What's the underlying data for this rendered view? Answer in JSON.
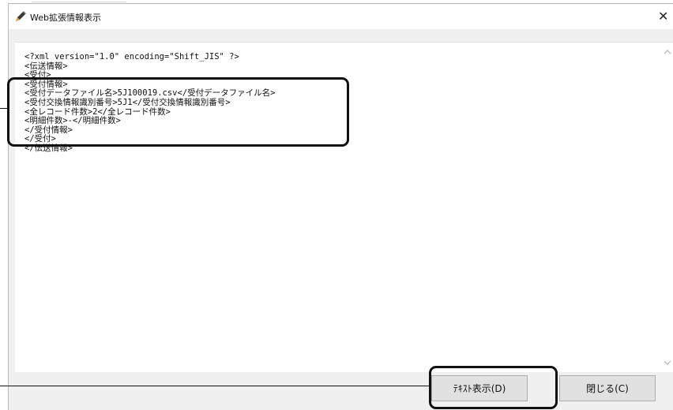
{
  "window": {
    "title": "Web拡張情報表示",
    "close_glyph": "✕"
  },
  "content": {
    "lines": [
      "<?xml version=\"1.0\" encoding=\"Shift_JIS\" ?>",
      "<伝送情報>",
      "<受付>",
      "<受付情報>",
      "<受付データファイル名>5J100019.csv</受付データファイル名>",
      "<受付交換情報識別番号>5J1</受付交換情報識別番号>",
      "<全レコード件数>2</全レコード件数>",
      "<明細件数>-</明細件数>",
      "</受付情報>",
      "</受付>",
      "</伝送情報>"
    ]
  },
  "buttons": {
    "text_view": "ﾃｷｽﾄ表示(D)",
    "close": "閉じる(C)"
  },
  "icons": {
    "app": "pen-icon",
    "close": "close-icon",
    "scroll_up": "chevron-up-icon",
    "scroll_down": "chevron-down-icon"
  }
}
